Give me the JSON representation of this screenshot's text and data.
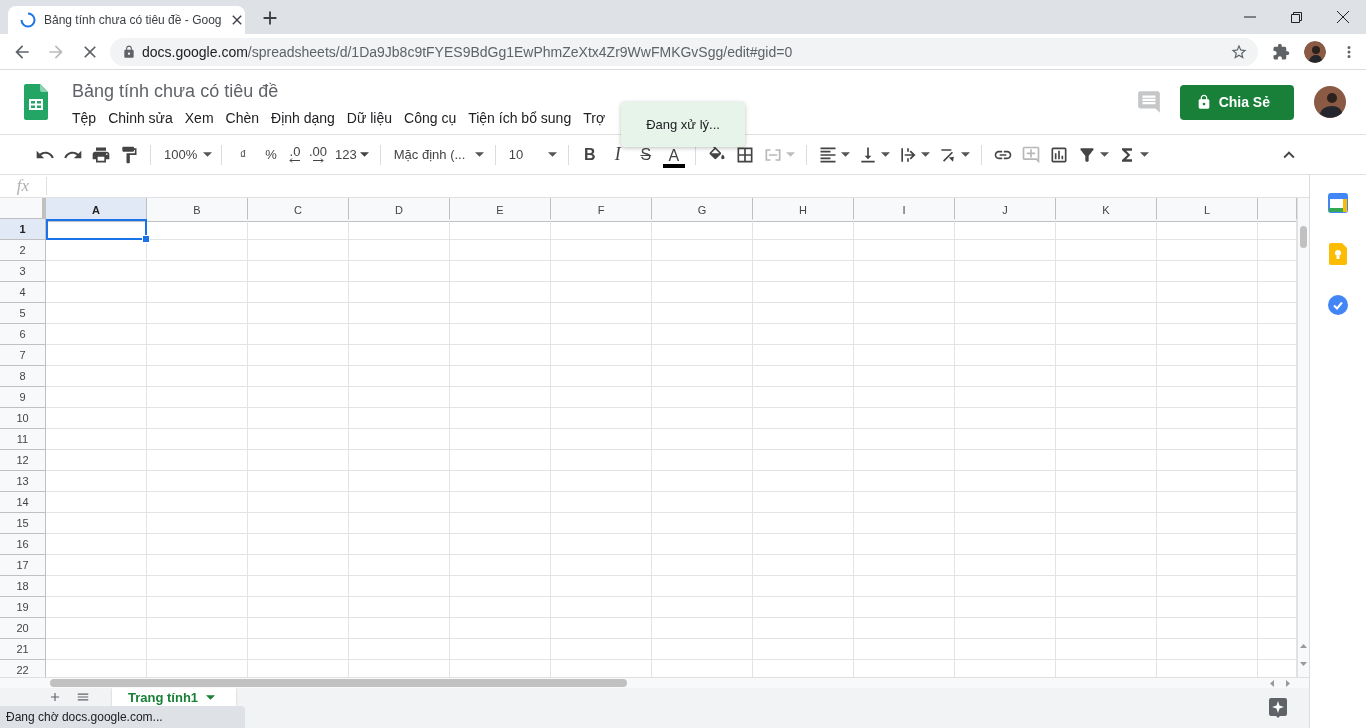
{
  "browser": {
    "tab": {
      "title": "Bảng tính chưa có tiêu đề - Goog",
      "loading": true
    },
    "url": {
      "host": "docs.google.com",
      "path": "/spreadsheets/d/1Da9Jb8c9tFYES9BdGg1EwPhmZeXtx4Zr9WwFMKGvSgg/edit#gid=0"
    }
  },
  "document": {
    "title": "Bảng tính chưa có tiêu đề",
    "share_button": "Chia Sẻ",
    "menu": [
      "Tệp",
      "Chỉnh sửa",
      "Xem",
      "Chèn",
      "Định dạng",
      "Dữ liệu",
      "Công cụ",
      "Tiện ích bổ sung",
      "Trợ"
    ]
  },
  "toast": "Đang xử lý...",
  "toolbar": {
    "groups": [
      [
        {
          "kind": "undo",
          "disabled": false
        },
        {
          "kind": "redo",
          "disabled": false
        },
        {
          "kind": "print",
          "disabled": false
        },
        {
          "kind": "paint_format",
          "disabled": false
        }
      ],
      [
        {
          "kind": "select",
          "text": "100%",
          "disabled": false
        }
      ],
      [
        {
          "kind": "text",
          "text": "₫",
          "disabled": false
        },
        {
          "kind": "text",
          "text": "%",
          "disabled": false
        },
        {
          "kind": "decimal_less",
          "text": ".0",
          "disabled": false
        },
        {
          "kind": "decimal_more",
          "text": ".00",
          "disabled": false
        },
        {
          "kind": "menu_text",
          "text": "123",
          "disabled": false
        }
      ],
      [
        {
          "kind": "select",
          "text": "Mặc định (...",
          "disabled": false
        }
      ],
      [
        {
          "kind": "select",
          "text": "10",
          "disabled": false
        }
      ],
      [
        {
          "kind": "bold",
          "text": "B",
          "disabled": false
        },
        {
          "kind": "italic",
          "text": "I",
          "disabled": false
        },
        {
          "kind": "strike",
          "text": "S",
          "disabled": false
        },
        {
          "kind": "text_color",
          "text": "A",
          "disabled": false
        }
      ],
      [
        {
          "kind": "fill_color",
          "disabled": false
        },
        {
          "kind": "borders",
          "disabled": false
        },
        {
          "kind": "merge",
          "disabled": true
        }
      ],
      [
        {
          "kind": "align",
          "disabled": false
        },
        {
          "kind": "valign",
          "disabled": false
        },
        {
          "kind": "wrap",
          "disabled": false
        },
        {
          "kind": "rotate",
          "disabled": false
        }
      ],
      [
        {
          "kind": "link",
          "disabled": false
        },
        {
          "kind": "comment",
          "disabled": true
        },
        {
          "kind": "chart",
          "disabled": false
        },
        {
          "kind": "filter",
          "disabled": false
        },
        {
          "kind": "sum",
          "disabled": false
        }
      ]
    ]
  },
  "formula_bar": {
    "label": "fx"
  },
  "sheet": {
    "columns": [
      {
        "label": "A",
        "selected": true
      },
      {
        "label": "B",
        "selected": false
      },
      {
        "label": "C",
        "selected": false
      },
      {
        "label": "D",
        "selected": false
      },
      {
        "label": "E",
        "selected": false
      },
      {
        "label": "F",
        "selected": false
      },
      {
        "label": "G",
        "selected": false
      },
      {
        "label": "H",
        "selected": false
      },
      {
        "label": "I",
        "selected": false
      },
      {
        "label": "J",
        "selected": false
      },
      {
        "label": "K",
        "selected": false
      },
      {
        "label": "L",
        "selected": false
      }
    ],
    "rows": [
      {
        "label": "1",
        "selected": true
      },
      {
        "label": "2",
        "selected": false
      },
      {
        "label": "3",
        "selected": false
      },
      {
        "label": "4",
        "selected": false
      },
      {
        "label": "5",
        "selected": false
      },
      {
        "label": "6",
        "selected": false
      },
      {
        "label": "7",
        "selected": false
      },
      {
        "label": "8",
        "selected": false
      },
      {
        "label": "9",
        "selected": false
      },
      {
        "label": "10",
        "selected": false
      },
      {
        "label": "11",
        "selected": false
      },
      {
        "label": "12",
        "selected": false
      },
      {
        "label": "13",
        "selected": false
      },
      {
        "label": "14",
        "selected": false
      },
      {
        "label": "15",
        "selected": false
      },
      {
        "label": "16",
        "selected": false
      },
      {
        "label": "17",
        "selected": false
      },
      {
        "label": "18",
        "selected": false
      },
      {
        "label": "19",
        "selected": false
      },
      {
        "label": "20",
        "selected": false
      },
      {
        "label": "21",
        "selected": false
      },
      {
        "label": "22",
        "selected": false
      }
    ]
  },
  "sheet_tabs": [
    {
      "label": "Trang tính1",
      "selected": true
    }
  ],
  "status": "Đang chờ docs.google.com..."
}
